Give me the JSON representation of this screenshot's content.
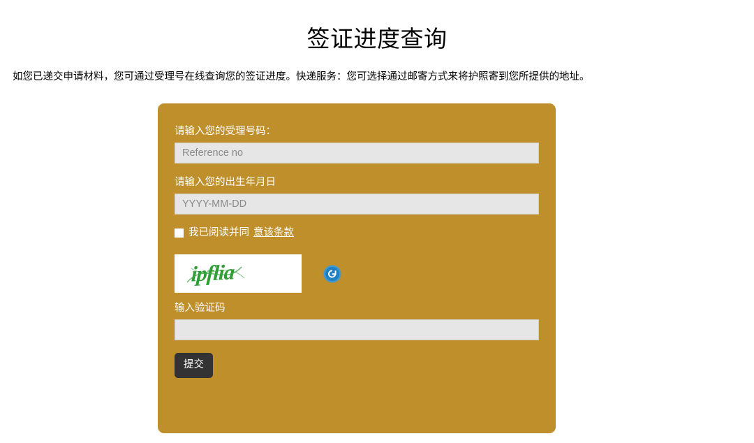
{
  "header": {
    "title": "签证进度查询",
    "description": "如您已递交申请材料，您可通过受理号在线查询您的签证进度。快递服务：您可选择通过邮寄方式来将护照寄到您所提供的地址。"
  },
  "form": {
    "reference": {
      "label": "请输入您的受理号码：",
      "placeholder": "Reference no",
      "value": ""
    },
    "birthdate": {
      "label": "请输入您的出生年月日",
      "placeholder": "YYYY-MM-DD",
      "value": ""
    },
    "agreement": {
      "checked": false,
      "text": "我已阅读并同",
      "link_text": "意该条款"
    },
    "captcha": {
      "image_text": "ipflia",
      "refresh_icon": "refresh-icon",
      "input_label": "输入验证码",
      "input_placeholder": "",
      "input_value": ""
    },
    "submit_label": "提交"
  },
  "colors": {
    "panel_background": "#bf8f2c",
    "input_background": "#e6e6e6",
    "submit_background": "#333333",
    "captcha_text": "#2e9e34",
    "refresh_icon": "#1f86c8",
    "page_background": "#ffffff",
    "label_text": "#ffffff"
  }
}
